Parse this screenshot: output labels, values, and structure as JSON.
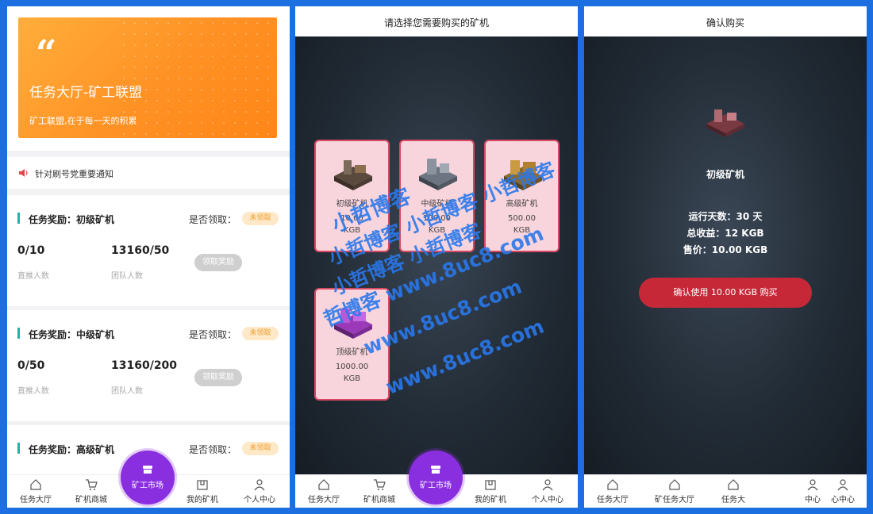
{
  "panel1": {
    "hero": {
      "quote": "“",
      "title": "任务大厅-矿工联盟",
      "subtitle": "矿工联盟,在于每一天的积累"
    },
    "notice": "针对刷号党重要通知",
    "tasks": [
      {
        "title": "任务奖励：初级矿机",
        "question": "是否领取：",
        "badge": "未领取",
        "v1": "0/10",
        "v2": "13160/50",
        "l1": "直推人数",
        "l2": "团队人数",
        "button": "领取奖励"
      },
      {
        "title": "任务奖励：中级矿机",
        "question": "是否领取：",
        "badge": "未领取",
        "v1": "0/50",
        "v2": "13160/200",
        "l1": "直推人数",
        "l2": "团队人数",
        "button": "领取奖励"
      },
      {
        "title": "任务奖励：高级矿机",
        "question": "是否领取：",
        "badge": "未领取"
      }
    ]
  },
  "tabs": {
    "task_hall": "任务大厅",
    "mall": "矿机商城",
    "market": "矿工市场",
    "my_miner": "我的矿机",
    "profile": "个人中心"
  },
  "panel2": {
    "title": "请选择您需要购买的矿机",
    "cards": [
      {
        "name": "初级矿机",
        "price": "10.00",
        "unit": "KGB"
      },
      {
        "name": "中级矿机",
        "price": "100.00",
        "unit": "KGB"
      },
      {
        "name": "高级矿机",
        "price": "500.00",
        "unit": "KGB"
      },
      {
        "name": "顶级矿机",
        "price": "1000.00",
        "unit": "KGB"
      }
    ],
    "watermark": {
      "line1": "小哲博客",
      "line2": "小哲博客 小哲博客 小哲博客",
      "line3": "小哲博客 小哲博客",
      "line4": "哲博客 www.8uc8.com",
      "line5": "www.8uc8.com",
      "line6": "www.8uc8.com"
    }
  },
  "panel3": {
    "title": "确认购买",
    "name": "初级矿机",
    "days": "运行天数：30 天",
    "income": "总收益：12 KGB",
    "price": "售价：10.00 KGB",
    "button": "确认使用 10.00 KGB 购买",
    "tabs": [
      "任务大厅",
      "矿任务大厅",
      "任务大",
      "中心",
      "心中心"
    ]
  },
  "colors": {
    "accent_purple": "#8a2fe0",
    "hero_orange": "#ff9124",
    "buy_red": "#c72838",
    "card_pink": "#f8d4dc",
    "badge_orange": "#f0a030"
  }
}
